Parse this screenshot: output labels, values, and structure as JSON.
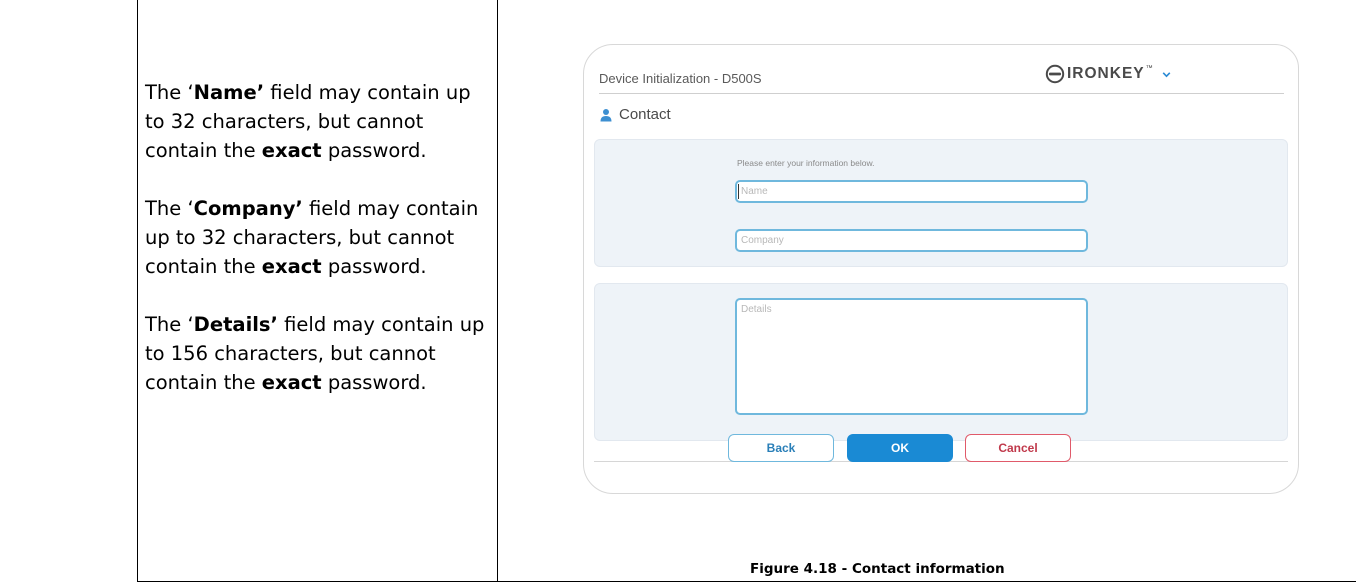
{
  "document": {
    "paragraphs": [
      {
        "lead": "The ‘",
        "field": "Name’",
        "middle": " field may contain up to 32 characters, but cannot contain the ",
        "emph": "exact",
        "tail": " password."
      },
      {
        "lead": "The ‘",
        "field": "Company’",
        "middle": " field may contain up to 32 characters, but cannot contain the ",
        "emph": "exact",
        "tail": " password."
      },
      {
        "lead": "The ‘",
        "field": "Details’",
        "middle": " field may contain up to 156 characters, but cannot contain the ",
        "emph": "exact",
        "tail": " password."
      }
    ],
    "caption": "Figure 4.18 - Contact information"
  },
  "dialog": {
    "title": "Device Initialization - D500S",
    "brand": "IRONKEY",
    "brand_tm": "™",
    "section_title": "Contact",
    "prompt": "Please enter your information below.",
    "fields": {
      "name_placeholder": "Name",
      "company_placeholder": "Company",
      "details_placeholder": "Details"
    },
    "buttons": {
      "back": "Back",
      "ok": "OK",
      "cancel": "Cancel"
    },
    "icons": {
      "brand": "ironkey-logo-icon",
      "menu": "chevron-down-icon",
      "section": "person-icon"
    },
    "colors": {
      "accent": "#1a8ad4",
      "field_border": "#6fb8dd",
      "cancel": "#e05a6a",
      "panel_bg": "#eef3f8",
      "section_icon": "#3d8fd1"
    }
  }
}
